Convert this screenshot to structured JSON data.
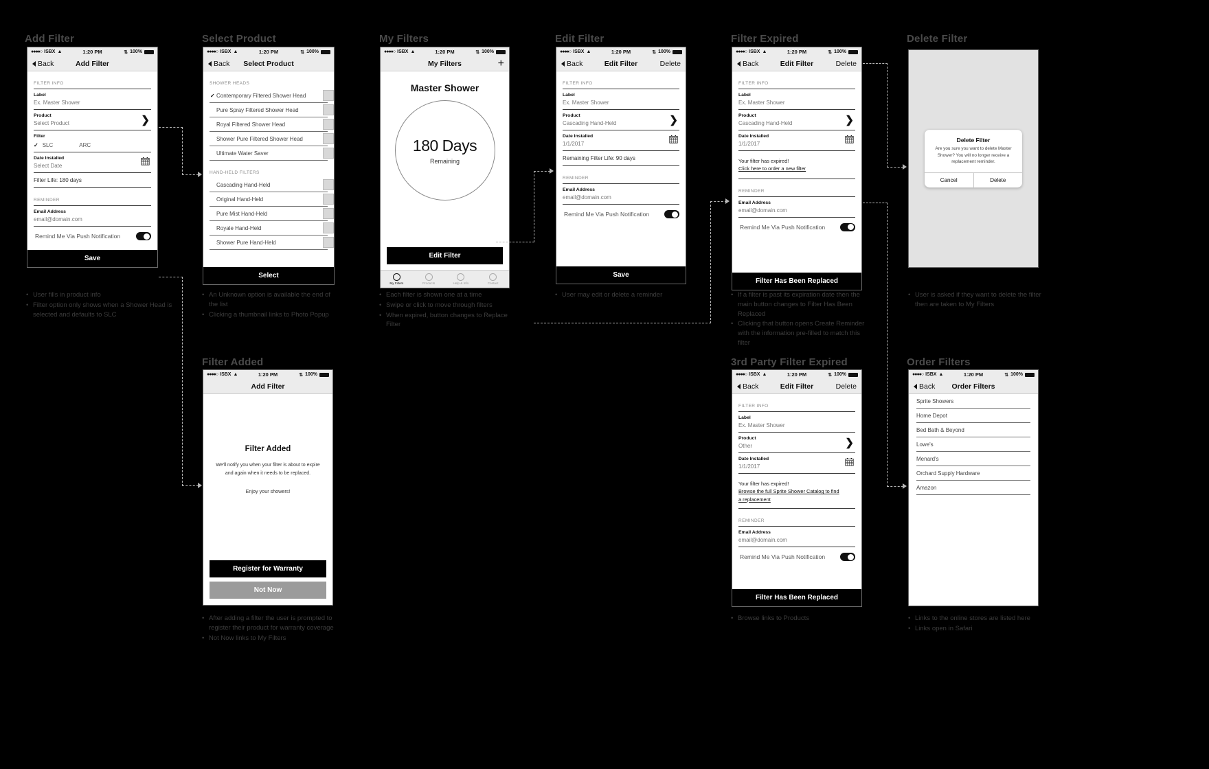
{
  "statusbar": {
    "carrier": "ISBX",
    "dots": "●●●●○",
    "time": "1:20 PM",
    "battery": "100%"
  },
  "common": {
    "back": "Back",
    "delete": "Delete",
    "filter_info": "FILTER INFO",
    "reminder": "REMINDER",
    "label_field": "Label",
    "label_value": "Ex. Master Shower",
    "product_field": "Product",
    "date_field": "Date Installed",
    "email_field": "Email Address",
    "email_value": "email@domain.com",
    "push_label": "Remind Me Via Push Notification",
    "save": "Save",
    "check": "✓"
  },
  "screens": {
    "add_filter": {
      "title": "Add Filter",
      "nav_title": "Add Filter",
      "product_value": "Select Product",
      "filter_field": "Filter",
      "filter_opt_1": "SLC",
      "filter_opt_2": "ARC",
      "date_value": "Select Date",
      "filter_life": "Filter Life: 180 days",
      "annotations": [
        "User fills in product info",
        "Filter option only shows when a Shower Head is selected and defaults to SLC"
      ]
    },
    "select_product": {
      "title": "Select Product",
      "nav_title": "Select Product",
      "group_1": "SHOWER HEADS",
      "group_2": "HAND-HELD FILTERS",
      "shower_heads": [
        "Contemporary Filtered Shower Head",
        "Pure Spray Filtered Shower Head",
        "Royal Filtered Shower Head",
        "Shower Pure Filtered Shower Head",
        "Ultimate Water Saver"
      ],
      "hand_held": [
        "Cascading Hand-Held",
        "Original Hand-Held",
        "Pure Mist Hand-Held",
        "Royale Hand-Held",
        "Shower Pure Hand-Held"
      ],
      "cta": "Select",
      "annotations": [
        "An Unknown option is available the end of the list",
        "Clicking a thumbnail links to Photo Popup"
      ]
    },
    "my_filters": {
      "title": "My Filters",
      "nav_title": "My Filters",
      "add_icon": "+",
      "filter_name": "Master Shower",
      "days": "180 Days",
      "days_sub": "Remaining",
      "cta": "Edit Filter",
      "tabs": [
        {
          "label": "My Filters",
          "active": true
        },
        {
          "label": "Products",
          "active": false
        },
        {
          "label": "Help & Info",
          "active": false
        },
        {
          "label": "Contact",
          "active": false
        }
      ],
      "annotations": [
        "Each filter is shown one at a time",
        "Swipe or click to move through filters",
        "When expired, button changes to Replace Filter"
      ]
    },
    "edit_filter": {
      "title": "Edit Filter",
      "nav_title": "Edit Filter",
      "product_value": "Cascading Hand-Held",
      "date_value": "1/1/2017",
      "remaining": "Remaining Filter Life: 90 days",
      "annotations": [
        "User may edit or delete a reminder"
      ]
    },
    "filter_expired": {
      "title": "Filter Expired",
      "nav_title": "Edit Filter",
      "product_value": "Cascading Hand-Held",
      "date_value": "1/1/2017",
      "expired_msg": "Your filter has expired!",
      "expired_link": "Click here to order a new filter",
      "cta": "Filter Has Been Replaced",
      "annotations": [
        "If a filter is past its expiration date then the main button changes to Filter Has Been Replaced",
        "Clicking that button opens Create Reminder with the information pre-filled to match this filter"
      ]
    },
    "delete_filter": {
      "title": "Delete Filter",
      "modal_title": "Delete Filter",
      "modal_text": "Are you sure you want to delete Master Shower? You will no longer receive a replacement reminder.",
      "cancel": "Cancel",
      "confirm": "Delete",
      "annotations": [
        "User is asked if they want to delete the filter then are taken to My Filters"
      ]
    },
    "filter_added": {
      "title": "Filter Added",
      "nav_title": "Add Filter",
      "heading": "Filter Added",
      "body": "We'll notify you when your filter is about to expire and again when it needs to be replaced.",
      "body2": "Enjoy your showers!",
      "primary_cta": "Register for Warranty",
      "secondary_cta": "Not Now",
      "annotations": [
        "After adding a filter the user is prompted to register their product for warranty coverage",
        "Not Now links to My Filters"
      ]
    },
    "third_party_expired": {
      "title": "3rd Party Filter Expired",
      "nav_title": "Edit Filter",
      "product_value": "Other",
      "date_value": "1/1/2017",
      "expired_msg": "Your filter has expired!",
      "expired_link_1": "Browse the full Sprite Shower Catalog to find",
      "expired_link_2": "a replacement",
      "cta": "Filter Has Been Replaced",
      "annotations": [
        "Browse links to Products"
      ]
    },
    "order_filters": {
      "title": "Order Filters",
      "nav_title": "Order Filters",
      "stores": [
        "Sprite Showers",
        "Home Depot",
        "Bed Bath & Beyond",
        "Lowe's",
        "Menard's",
        "Orchard Supply Hardware",
        "Amazon"
      ],
      "annotations": [
        "Links to the online stores are listed here",
        "Links open in Safari"
      ]
    }
  }
}
